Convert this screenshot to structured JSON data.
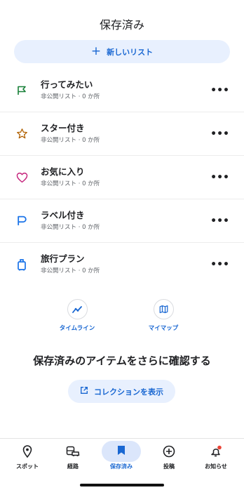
{
  "header": {
    "title": "保存済み"
  },
  "new_list": {
    "plus": "+",
    "label": "新しいリスト"
  },
  "lists": [
    {
      "title": "行ってみたい",
      "subtitle": "非公開リスト · 0 か所",
      "icon": "flag-icon",
      "color": "#188038"
    },
    {
      "title": "スター付き",
      "subtitle": "非公開リスト · 0 か所",
      "icon": "star-icon",
      "color": "#b06000"
    },
    {
      "title": "お気に入り",
      "subtitle": "非公開リスト · 0 か所",
      "icon": "heart-icon",
      "color": "#c5227b"
    },
    {
      "title": "ラベル付き",
      "subtitle": "非公開リスト · 0 か所",
      "icon": "label-icon",
      "color": "#1a73e8"
    },
    {
      "title": "旅行プラン",
      "subtitle": "非公開リスト · 0 か所",
      "icon": "suitcase-icon",
      "color": "#1a73e8"
    }
  ],
  "more_symbol": "•••",
  "quick_links": [
    {
      "label": "タイムライン",
      "icon": "timeline-icon"
    },
    {
      "label": "マイマップ",
      "icon": "map-icon"
    }
  ],
  "more_section": {
    "title": "保存済みのアイテムをさらに確認する",
    "button_label": "コレクションを表示"
  },
  "bottom_nav": [
    {
      "label": "スポット",
      "icon": "location-pin-icon"
    },
    {
      "label": "経路",
      "icon": "commute-icon"
    },
    {
      "label": "保存済み",
      "icon": "bookmark-icon",
      "active": true
    },
    {
      "label": "投稿",
      "icon": "add-circle-icon"
    },
    {
      "label": "お知らせ",
      "icon": "bell-icon"
    }
  ],
  "colors": {
    "accent": "#1967d2",
    "pill_bg": "#e8f0fe",
    "notification_dot": "#ea4335"
  }
}
